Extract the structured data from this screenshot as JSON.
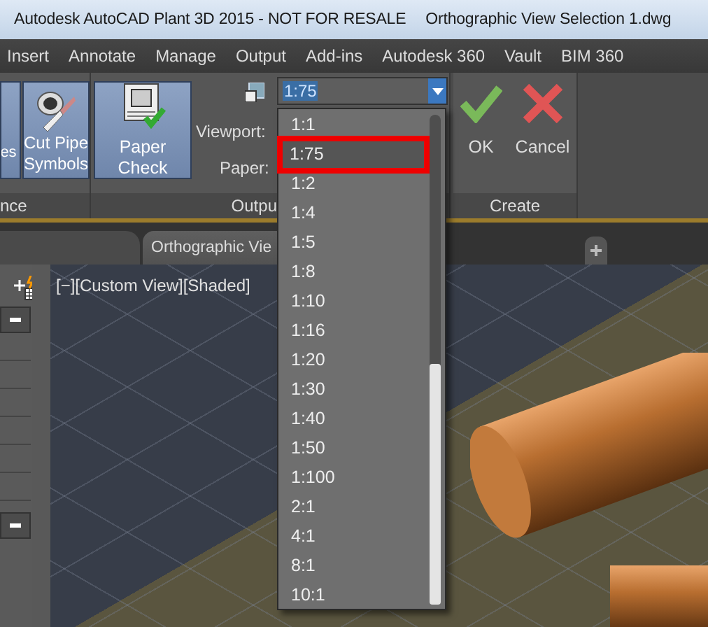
{
  "window": {
    "title": "Autodesk AutoCAD Plant 3D 2015 - NOT FOR RESALE",
    "document": "Orthographic View Selection 1.dwg"
  },
  "ribbon_tabs": [
    "Insert",
    "Annotate",
    "Manage",
    "Output",
    "Add-ins",
    "Autodesk 360",
    "Vault",
    "BIM 360"
  ],
  "left_panel": {
    "title": "nce",
    "buttons": [
      "es",
      "Cut Pipe Symbols"
    ]
  },
  "output_panel": {
    "title": "Outpu",
    "button": "Paper Check",
    "fields": [
      "Viewport:",
      "Paper:"
    ]
  },
  "create_panel": {
    "title": "Create",
    "buttons": [
      {
        "label": "OK",
        "kind": "ok"
      },
      {
        "label": "Cancel",
        "kind": "cancel"
      }
    ]
  },
  "document_tabs": [
    {
      "label": "Orthographic Vie"
    }
  ],
  "viewport": {
    "label": "[−][Custom View][Shaded]"
  },
  "scale_dropdown": {
    "value": "1:75",
    "expanded": true,
    "options": [
      {
        "label": "1:1",
        "selected": false
      },
      {
        "label": "1:75",
        "selected": true
      },
      {
        "label": "1:2",
        "selected": false
      },
      {
        "label": "1:4",
        "selected": false
      },
      {
        "label": "1:5",
        "selected": false
      },
      {
        "label": "1:8",
        "selected": false
      },
      {
        "label": "1:10",
        "selected": false
      },
      {
        "label": "1:16",
        "selected": false
      },
      {
        "label": "1:20",
        "selected": false
      },
      {
        "label": "1:30",
        "selected": false
      },
      {
        "label": "1:40",
        "selected": false
      },
      {
        "label": "1:50",
        "selected": false
      },
      {
        "label": "1:100",
        "selected": false
      },
      {
        "label": "2:1",
        "selected": false
      },
      {
        "label": "4:1",
        "selected": false
      },
      {
        "label": "8:1",
        "selected": false
      },
      {
        "label": "10:1",
        "selected": false
      }
    ]
  }
}
